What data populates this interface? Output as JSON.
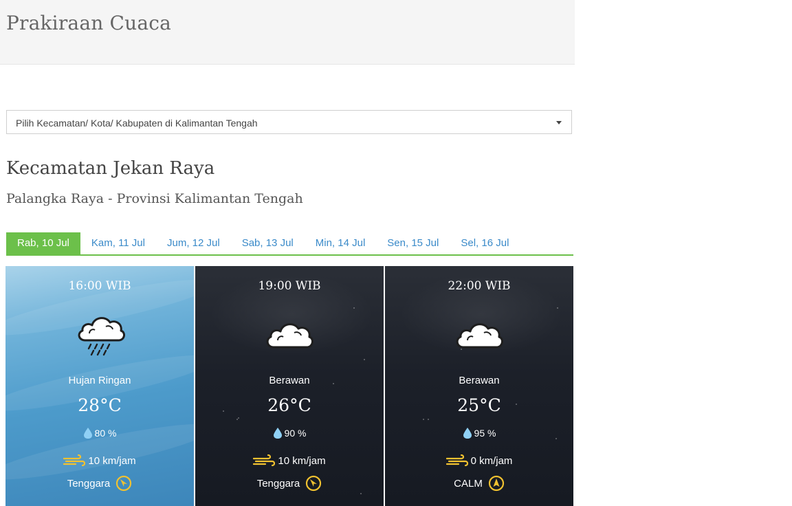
{
  "header": {
    "title": "Prakiraan Cuaca"
  },
  "location_select": {
    "placeholder": "Pilih Kecamatan/ Kota/ Kabupaten di Kalimantan Tengah"
  },
  "location": {
    "title": "Kecamatan Jekan Raya",
    "subtitle": "Palangka Raya - Provinsi Kalimantan Tengah"
  },
  "tabs": [
    {
      "label": "Rab, 10 Jul",
      "active": true
    },
    {
      "label": "Kam, 11 Jul"
    },
    {
      "label": "Jum, 12 Jul"
    },
    {
      "label": "Sab, 13 Jul"
    },
    {
      "label": "Min, 14 Jul"
    },
    {
      "label": "Sen, 15 Jul"
    },
    {
      "label": "Sel, 16 Jul"
    }
  ],
  "forecasts": [
    {
      "time": "16:00 WIB",
      "condition": "Hujan Ringan",
      "icon": "rain-cloud-icon",
      "temp": "28°C",
      "humidity": "80 %",
      "wind_speed": "10 km/jam",
      "wind_dir": "Tenggara"
    },
    {
      "time": "19:00 WIB",
      "condition": "Berawan",
      "icon": "cloud-icon",
      "temp": "26°C",
      "humidity": "90 %",
      "wind_speed": "10 km/jam",
      "wind_dir": "Tenggara"
    },
    {
      "time": "22:00 WIB",
      "condition": "Berawan",
      "icon": "cloud-icon",
      "temp": "25°C",
      "humidity": "95 %",
      "wind_speed": "0 km/jam",
      "wind_dir": "CALM"
    }
  ],
  "colors": {
    "accent_green": "#6cc04a",
    "tab_link": "#3a8ac9",
    "wind_icon": "#f2c230",
    "humidity_icon": "#8fd0f5"
  }
}
